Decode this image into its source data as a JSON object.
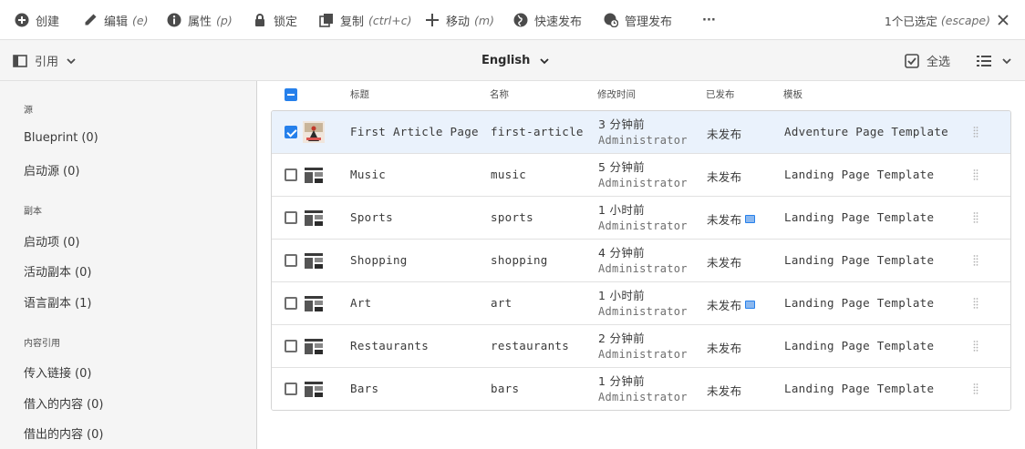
{
  "actions": {
    "create": "创建",
    "edit": "编辑",
    "edit_hint": "(e)",
    "properties": "属性",
    "properties_hint": "(p)",
    "lock": "锁定",
    "copy": "复制",
    "copy_hint": "(ctrl+c)",
    "move": "移动",
    "move_hint": "(m)",
    "quick_publish": "快速发布",
    "manage_publish": "管理发布",
    "more": "···",
    "selection_status": "1个已选定",
    "selection_hint": "(escape)"
  },
  "topbar": {
    "rail_label": "引用",
    "language": "English",
    "select_all": "全选"
  },
  "rail": {
    "sections": [
      {
        "heading": "源",
        "items": [
          {
            "label": "Blueprint",
            "count": "(0)"
          },
          {
            "label": "启动源",
            "count": "(0)"
          }
        ]
      },
      {
        "heading": "副本",
        "items": [
          {
            "label": "启动项",
            "count": "(0)"
          },
          {
            "label": "活动副本",
            "count": "(0)"
          },
          {
            "label": "语言副本",
            "count": "(1)"
          }
        ]
      },
      {
        "heading": "内容引用",
        "items": [
          {
            "label": "传入链接",
            "count": "(0)"
          },
          {
            "label": "借入的内容",
            "count": "(0)"
          },
          {
            "label": "借出的内容",
            "count": "(0)"
          }
        ]
      }
    ]
  },
  "list": {
    "columns": [
      "标题",
      "名称",
      "修改时间",
      "已发布",
      "模板"
    ],
    "rows": [
      {
        "title": "First Article Page",
        "name": "first-article",
        "modified": "3 分钟前",
        "modified_by": "Administrator",
        "published": "未发布",
        "template": "Adventure Page Template",
        "selected": true,
        "note": false
      },
      {
        "title": "Music",
        "name": "music",
        "modified": "5 分钟前",
        "modified_by": "Administrator",
        "published": "未发布",
        "template": "Landing Page Template",
        "selected": false,
        "note": false
      },
      {
        "title": "Sports",
        "name": "sports",
        "modified": "1 小时前",
        "modified_by": "Administrator",
        "published": "未发布",
        "template": "Landing Page Template",
        "selected": false,
        "note": true
      },
      {
        "title": "Shopping",
        "name": "shopping",
        "modified": "4 分钟前",
        "modified_by": "Administrator",
        "published": "未发布",
        "template": "Landing Page Template",
        "selected": false,
        "note": false
      },
      {
        "title": "Art",
        "name": "art",
        "modified": "1 小时前",
        "modified_by": "Administrator",
        "published": "未发布",
        "template": "Landing Page Template",
        "selected": false,
        "note": true
      },
      {
        "title": "Restaurants",
        "name": "restaurants",
        "modified": "2 分钟前",
        "modified_by": "Administrator",
        "published": "未发布",
        "template": "Landing Page Template",
        "selected": false,
        "note": false
      },
      {
        "title": "Bars",
        "name": "bars",
        "modified": "1 分钟前",
        "modified_by": "Administrator",
        "published": "未发布",
        "template": "Landing Page Template",
        "selected": false,
        "note": false
      }
    ]
  },
  "colors": {
    "accent": "#2680eb",
    "selected_row": "#eaf2fc",
    "rail_bg": "#f5f5f5"
  }
}
